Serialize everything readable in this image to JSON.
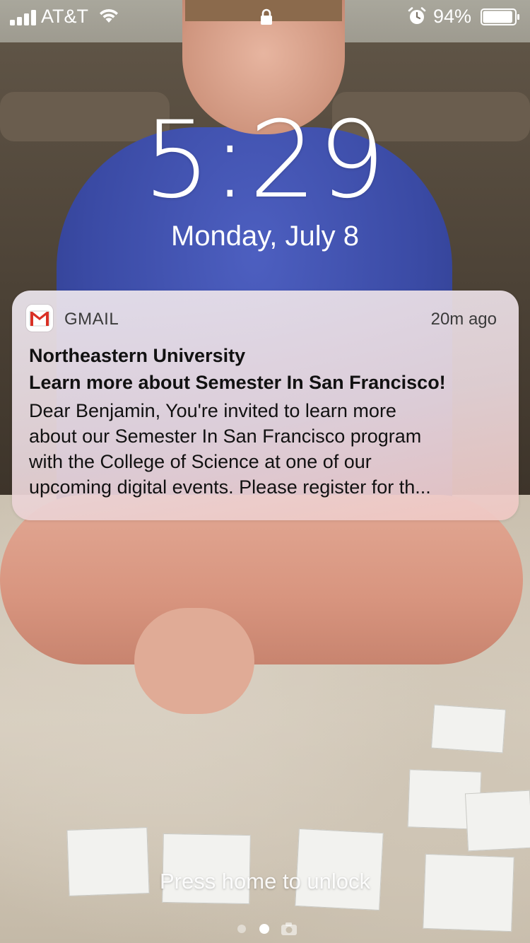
{
  "status_bar": {
    "carrier": "AT&T",
    "battery_percent": "94%",
    "battery_level": 0.94,
    "signal_bars": 4
  },
  "lock_screen": {
    "time": "5:29",
    "date": "Monday, July 8"
  },
  "notification": {
    "app_name": "GMAIL",
    "timestamp": "20m ago",
    "sender": "Northeastern University",
    "subject": "Learn more about Semester In San Francisco!",
    "body_lines": [
      "Dear Benjamin, You're invited to learn more",
      "about our Semester In San Francisco program",
      "with the College of Science at one of our",
      "upcoming digital events. Please register for th..."
    ]
  },
  "bottom": {
    "unlock_hint": "Press home to unlock"
  },
  "colors": {
    "gmail_red": "#d93025",
    "text_white": "#ffffff"
  },
  "icons": [
    "signal-icon",
    "wifi-icon",
    "lock-icon",
    "alarm-icon",
    "battery-icon",
    "gmail-icon",
    "camera-icon"
  ]
}
